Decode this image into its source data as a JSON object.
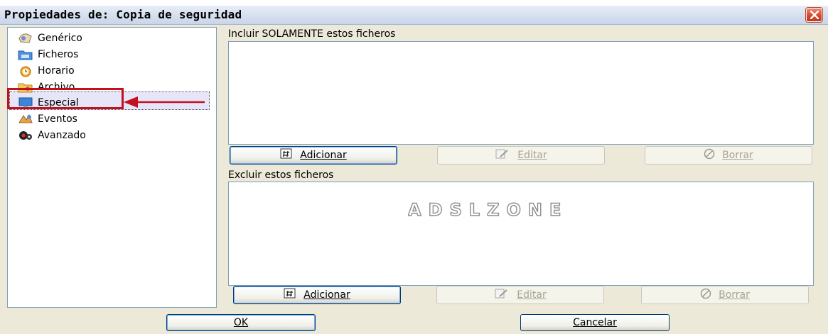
{
  "window": {
    "title": "Propiedades de: Copia de seguridad",
    "close_icon": "close-icon"
  },
  "sidebar": {
    "items": [
      {
        "label": "Genérico",
        "icon": "generic-icon"
      },
      {
        "label": "Ficheros",
        "icon": "folder-icon"
      },
      {
        "label": "Horario",
        "icon": "alarm-clock-icon"
      },
      {
        "label": "Archivo",
        "icon": "archive-folder-icon"
      },
      {
        "label": "Especial",
        "icon": "monitor-icon",
        "selected": true
      },
      {
        "label": "Eventos",
        "icon": "events-icon"
      },
      {
        "label": "Avanzado",
        "icon": "advanced-icon"
      }
    ],
    "highlight_color": "#c4101e"
  },
  "include": {
    "label": "Incluir SOLAMENTE estos ficheros",
    "add_label": "Adicionar",
    "edit_label": "Editar",
    "delete_label": "Borrar"
  },
  "exclude": {
    "label": "Excluir estos ficheros",
    "add_label": "Adicionar",
    "edit_label": "Editar",
    "delete_label": "Borrar"
  },
  "watermark": {
    "text": "ADSLZONE"
  },
  "footer": {
    "ok_label": "OK",
    "cancel_label": "Cancelar"
  }
}
